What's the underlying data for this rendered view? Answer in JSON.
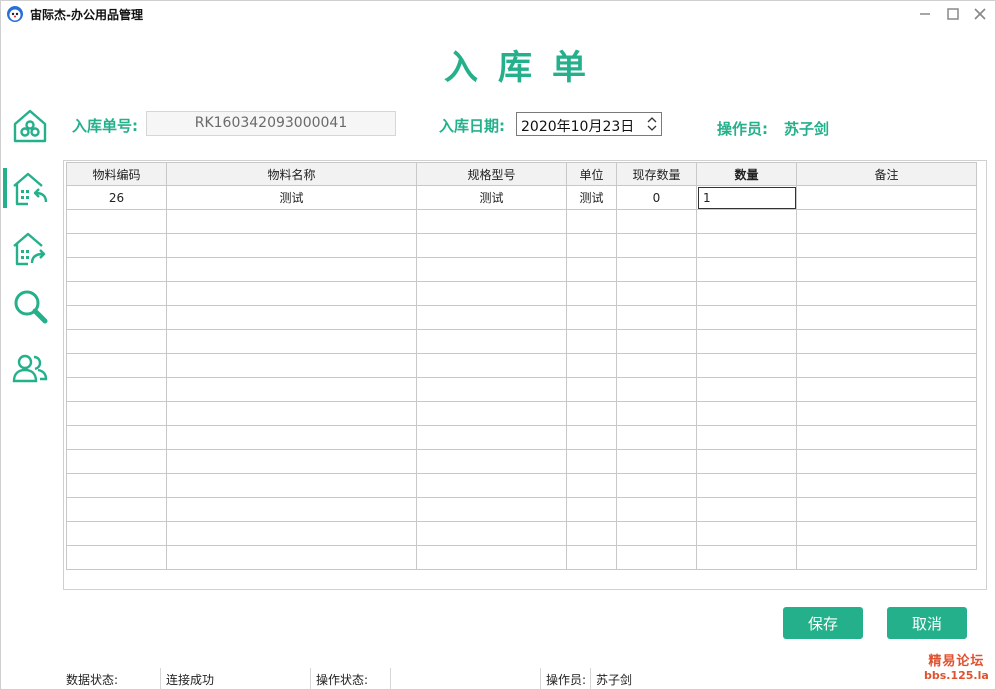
{
  "window": {
    "title": "宙际杰-办公用品管理",
    "controls": {
      "minimize": "minimize-icon",
      "maximize": "maximize-icon",
      "close": "close-icon"
    }
  },
  "heading": "入库单",
  "sidebar": {
    "items": [
      {
        "icon": "home-icon"
      },
      {
        "icon": "stock-in-icon",
        "active": true
      },
      {
        "icon": "stock-out-icon"
      },
      {
        "icon": "search-icon"
      },
      {
        "icon": "users-icon"
      }
    ]
  },
  "form": {
    "order_no_label": "入库单号:",
    "order_no_value": "RK160342093000041",
    "date_label": "入库日期:",
    "date_value": "2020年10月23日",
    "operator_label": "操作员:",
    "operator_value": "苏子剑"
  },
  "table": {
    "columns": [
      "物料编码",
      "物料名称",
      "规格型号",
      "单位",
      "现存数量",
      "数量",
      "备注"
    ],
    "rows": [
      [
        "26",
        "测试",
        "测试",
        "测试",
        "0",
        "1",
        ""
      ]
    ]
  },
  "buttons": {
    "save": "保存",
    "cancel": "取消"
  },
  "statusbar": {
    "data_status_label": "数据状态:",
    "data_status_value": "连接成功",
    "op_status_label": "操作状态:",
    "op_status_value": "",
    "operator_label": "操作员:",
    "operator_value": "苏子剑"
  },
  "watermark": {
    "line1": "精易论坛",
    "line2": "bbs.125.la"
  },
  "colors": {
    "accent": "#25b08c",
    "watermark": "#e0522f"
  }
}
